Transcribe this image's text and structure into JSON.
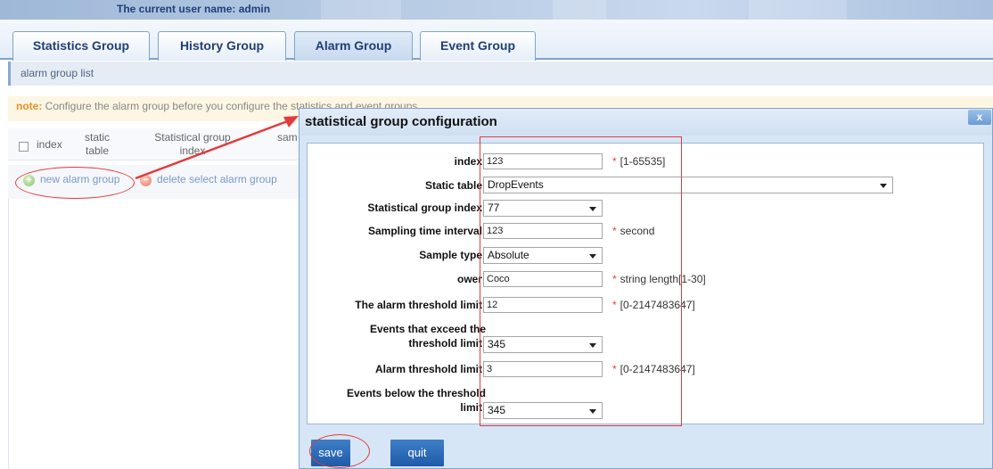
{
  "header": {
    "user_label": "The current user name: admin"
  },
  "tabs": [
    {
      "label": "Statistics Group"
    },
    {
      "label": "History Group"
    },
    {
      "label": "Alarm Group"
    },
    {
      "label": "Event Group"
    }
  ],
  "list": {
    "title": "alarm group list",
    "note_label": "note:",
    "note_text": "Configure the alarm group before you configure the statistics and event groups.",
    "columns": [
      "index",
      "static table",
      "Statistical group index",
      "sam"
    ],
    "actions": {
      "new": "new alarm group",
      "delete": "delete select alarm group"
    }
  },
  "dialog": {
    "title": "statistical group configuration",
    "close": "x",
    "fields": {
      "index": {
        "label": "index:",
        "value": "123",
        "hint": "[1-65535]"
      },
      "static_table": {
        "label": "Static table:",
        "value": "DropEvents"
      },
      "stat_group_index": {
        "label": "Statistical group index:",
        "value": "77"
      },
      "sampling_interval": {
        "label": "Sampling time interval:",
        "value": "123",
        "hint": "second"
      },
      "sample_type": {
        "label": "Sample type:",
        "value": "Absolute"
      },
      "owner": {
        "label": "ower:",
        "value": "Coco",
        "hint": "string length[1-30]"
      },
      "alarm_threshold_limit": {
        "label": "The alarm threshold limit:",
        "value": "12",
        "hint": "[0-2147483647]"
      },
      "events_exceed": {
        "label_line1": "Events that exceed the",
        "label_line2": "threshold limit:",
        "value": "345"
      },
      "alarm_threshold_limit2": {
        "label": "Alarm threshold limit:",
        "value": "3",
        "hint": "[0-2147483647]"
      },
      "events_below": {
        "label_line1": "Events below the threshold",
        "label_line2": "limit:",
        "value": "345"
      }
    },
    "buttons": {
      "save": "save",
      "quit": "quit"
    }
  },
  "colors": {
    "accent": "#1e5aa8",
    "annotation": "#e23b3b",
    "required_star": "#e04040"
  }
}
